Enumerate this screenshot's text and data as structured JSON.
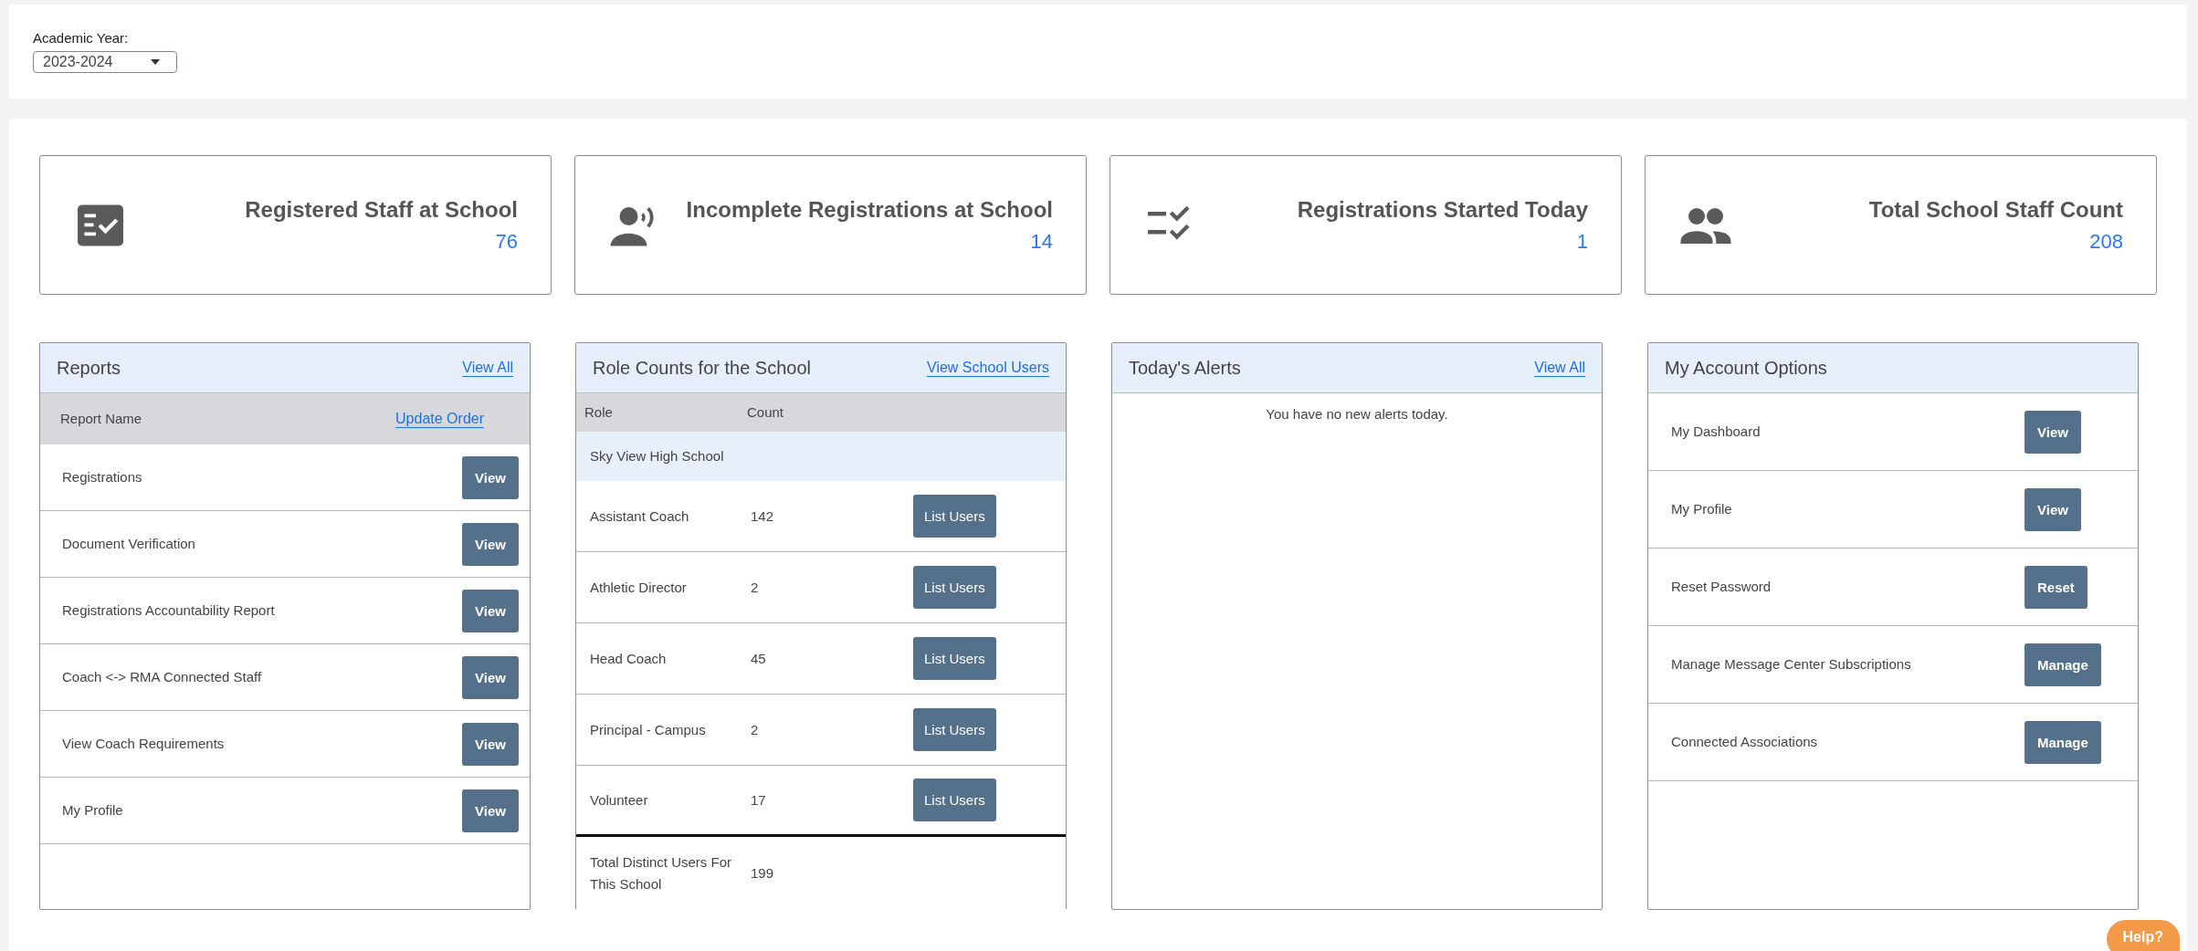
{
  "filter": {
    "label": "Academic Year:",
    "value": "2023-2024"
  },
  "stats": [
    {
      "title": "Registered Staff at School",
      "value": "76"
    },
    {
      "title": "Incomplete Registrations at School",
      "value": "14"
    },
    {
      "title": "Registrations Started Today",
      "value": "1"
    },
    {
      "title": "Total School Staff Count",
      "value": "208"
    }
  ],
  "reports": {
    "title": "Reports",
    "link": "View All",
    "columns": {
      "name": "Report Name",
      "action": "Update Order"
    },
    "rows": [
      {
        "name": "Registrations",
        "button": "View"
      },
      {
        "name": "Document Verification",
        "button": "View"
      },
      {
        "name": "Registrations Accountability Report",
        "button": "View"
      },
      {
        "name": "Coach <-> RMA Connected Staff",
        "button": "View"
      },
      {
        "name": "View Coach Requirements",
        "button": "View"
      },
      {
        "name": "My Profile",
        "button": "View"
      }
    ]
  },
  "roles": {
    "title": "Role Counts for the School",
    "link": "View School Users",
    "columns": [
      "Role",
      "Count"
    ],
    "group": "Sky View High School",
    "rows": [
      {
        "role": "Assistant Coach",
        "count": "142",
        "button": "List Users"
      },
      {
        "role": "Athletic Director",
        "count": "2",
        "button": "List Users"
      },
      {
        "role": "Head Coach",
        "count": "45",
        "button": "List Users"
      },
      {
        "role": "Principal - Campus",
        "count": "2",
        "button": "List Users"
      },
      {
        "role": "Volunteer",
        "count": "17",
        "button": "List Users"
      }
    ],
    "total": {
      "label": "Total Distinct Users For This School",
      "count": "199"
    }
  },
  "alerts": {
    "title": "Today's Alerts",
    "link": "View All",
    "message": "You have no new alerts today."
  },
  "account": {
    "title": "My Account Options",
    "rows": [
      {
        "name": "My Dashboard",
        "button": "View"
      },
      {
        "name": "My Profile",
        "button": "View"
      },
      {
        "name": "Reset Password",
        "button": "Reset"
      },
      {
        "name": "Manage Message Center Subscriptions",
        "button": "Manage"
      },
      {
        "name": "Connected Associations",
        "button": "Manage"
      }
    ]
  },
  "help": "Help?"
}
